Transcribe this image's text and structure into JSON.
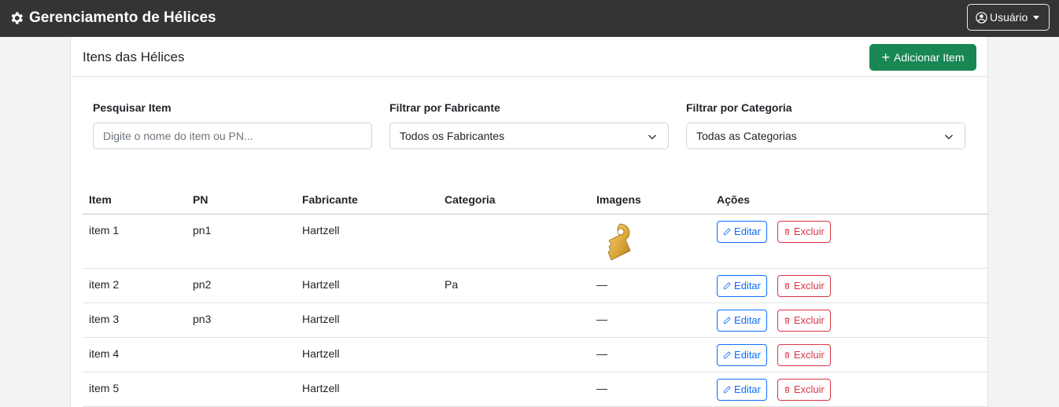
{
  "navbar": {
    "title": "Gerenciamento de Hélices",
    "user_label": "Usuário"
  },
  "card": {
    "title": "Itens das Hélices",
    "add_button": "Adicionar Item"
  },
  "filters": {
    "search_label": "Pesquisar Item",
    "search_placeholder": "Digite o nome do item ou PN...",
    "manufacturer_label": "Filtrar por Fabricante",
    "manufacturer_value": "Todos os Fabricantes",
    "category_label": "Filtrar por Categoria",
    "category_value": "Todas as Categorias"
  },
  "table": {
    "headers": [
      "Item",
      "PN",
      "Fabricante",
      "Categoria",
      "Imagens",
      "Ações"
    ],
    "rows": [
      {
        "item": "item 1",
        "pn": "pn1",
        "fabricante": "Hartzell",
        "categoria": "",
        "imagens": "",
        "edit": "Editar",
        "delete": "Excluir"
      },
      {
        "item": "item 2",
        "pn": "pn2",
        "fabricante": "Hartzell",
        "categoria": "Pa",
        "imagens": "—",
        "edit": "Editar",
        "delete": "Excluir"
      },
      {
        "item": "item 3",
        "pn": "pn3",
        "fabricante": "Hartzell",
        "categoria": "",
        "imagens": "—",
        "edit": "Editar",
        "delete": "Excluir"
      },
      {
        "item": "item 4",
        "pn": "",
        "fabricante": "Hartzell",
        "categoria": "",
        "imagens": "—",
        "edit": "Editar",
        "delete": "Excluir"
      },
      {
        "item": "item 5",
        "pn": "",
        "fabricante": "Hartzell",
        "categoria": "",
        "imagens": "—",
        "edit": "Editar",
        "delete": "Excluir"
      }
    ]
  },
  "colors": {
    "navbar": "#343434",
    "success": "#198754",
    "primary": "#0d6efd",
    "danger": "#dc3545"
  },
  "icons": {
    "brand": "gear-icon",
    "user": "user-circle-icon",
    "add": "plus-icon",
    "edit": "pencil-icon",
    "delete": "trash-icon",
    "image": "part-thumbnail"
  }
}
